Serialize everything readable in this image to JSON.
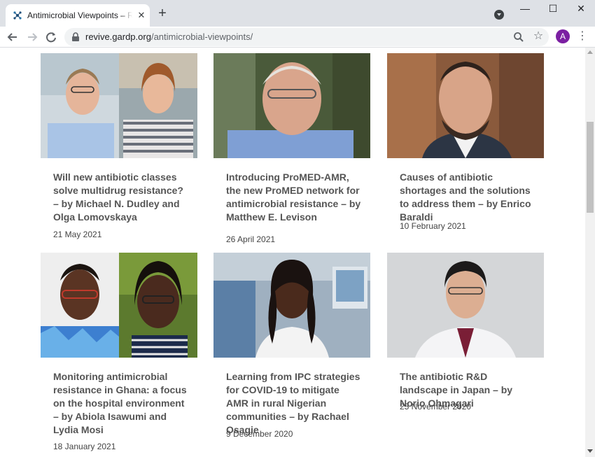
{
  "browser": {
    "tab_title": "Antimicrobial Viewpoints – REVIVE",
    "tab_close": "✕",
    "new_tab": "+",
    "minimize": "—",
    "maximize": "☐",
    "close": "✕",
    "url_host": "revive.gardp.org",
    "url_path": "/antimicrobial-viewpoints/",
    "avatar_letter": "A",
    "icons": [
      "back-arrow-icon",
      "forward-arrow-icon",
      "reload-icon",
      "lock-icon",
      "zoom-icon",
      "star-icon",
      "menu-icon"
    ]
  },
  "articles": [
    {
      "title": "Will new antibiotic classes solve multidrug resistance? – by Michael N. Dudley and Olga Lomovskaya",
      "date": "21 May 2021",
      "image": "two-portraits-lab"
    },
    {
      "title": "Introducing ProMED-AMR, the new ProMED network for antimicrobial resistance – by Matthew E. Levison",
      "date": "26 April 2021",
      "image": "portrait-older-man"
    },
    {
      "title": "Causes of antibiotic shortages and the solutions to address them – by Enrico Baraldi",
      "date": "10 February 2021",
      "image": "portrait-bearded-man"
    },
    {
      "title": "Monitoring antimicrobial resistance in Ghana: a focus on the hospital environment – by Abiola Isawumi and Lydia Mosi",
      "date": "18 January 2021",
      "image": "two-portraits-ghana"
    },
    {
      "title": "Learning from IPC strategies for COVID-19 to mitigate AMR in rural Nigerian communities – by Rachael Osagie",
      "date": "9 December 2020",
      "image": "portrait-woman-lab"
    },
    {
      "title": "The antibiotic R&D landscape in Japan – by Norio Ohmagari",
      "date": "25 November 2020",
      "image": "portrait-man-white-coat"
    }
  ],
  "colors": {
    "title": "#555555",
    "date": "#444444",
    "chrome": "#dee1e6",
    "avatar": "#7b1fa2"
  }
}
